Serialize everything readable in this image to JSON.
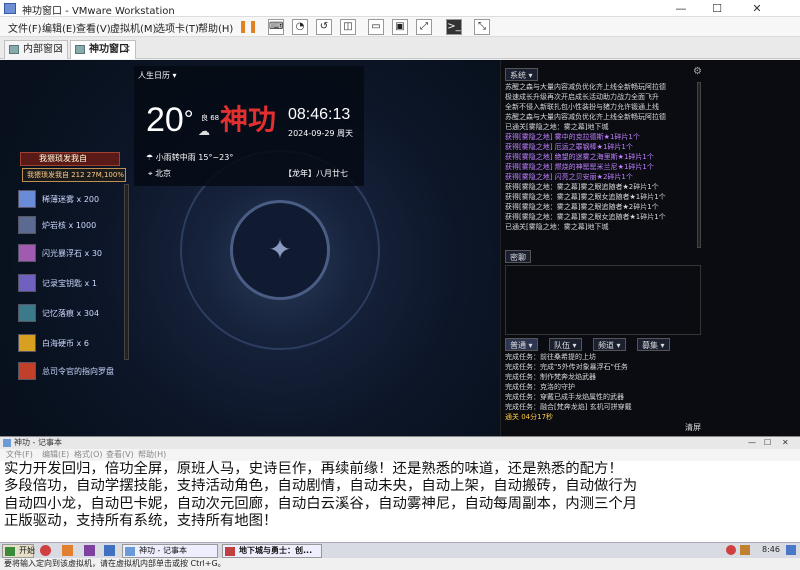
{
  "window": {
    "title": "神功窗口 - VMware Workstation"
  },
  "menubar": {
    "items": [
      "文件(F)",
      "编辑(E)",
      "查看(V)",
      "虚拟机(M)",
      "选项卡(T)",
      "帮助(H)"
    ]
  },
  "tabs": [
    {
      "label": "内部窗口",
      "active": false
    },
    {
      "label": "神功窗口",
      "active": true
    }
  ],
  "weather": {
    "calendar": "人生日历",
    "temperature": "20",
    "degree": "°",
    "aqi": "良 68",
    "brand": "神功",
    "time": "08:46:13",
    "date": "2024-09-29 周天",
    "condition": "小雨转中雨 15°~23°",
    "city": "北京",
    "lunar": "【龙年】八月廿七"
  },
  "inventory": {
    "header": "我猥琐发我自",
    "tooltip": "我猥琐发我自  212 27M,100%",
    "items": [
      {
        "label": "稀薄迷雾 x 200",
        "color": "#6a8cd8"
      },
      {
        "label": "炉岩核 x 1000",
        "color": "#5a6a90"
      },
      {
        "label": "闪光暴浮石 x 30",
        "color": "#a05ab0"
      },
      {
        "label": "记录宝钥匙 x 1",
        "color": "#7060c0"
      },
      {
        "label": "记忆落痕 x 304",
        "color": "#3a7a8a"
      },
      {
        "label": "白海硬币 x 6",
        "color": "#d8a020"
      },
      {
        "label": "总司令官的指向罗盘",
        "color": "#c0402a"
      }
    ]
  },
  "chat": {
    "system_tab": "系统",
    "gear": "⚙",
    "system_lines": [
      {
        "text": "苏醒之森与大量内容减负优化齐上线全新畅玩阿拉德",
        "color": "#d8d8d8"
      },
      {
        "text": "极速成长升级再次开启成长活动助力战力全面飞升",
        "color": "#d8d8d8"
      },
      {
        "text": "全新不侵入新联扎包小性装扮与猪力允许锻通上线",
        "color": "#d8d8d8"
      },
      {
        "text": "苏醒之森与大量内容减负优化齐上线全新畅玩阿拉德",
        "color": "#d8d8d8"
      },
      {
        "text": "已通关[雾隐之地：雾之幕]地下城",
        "color": "#d8d8d8"
      },
      {
        "text": "获得[雾隐之地] 雾中的克拉德斯★1碎片1个",
        "color": "#c080ff"
      },
      {
        "text": "获得[雾隐之地] 厄运之罪钢棒★1碎片1个",
        "color": "#c080ff"
      },
      {
        "text": "获得[雾隐之地] 绝望的迷雾之海里斯★1碎片1个",
        "color": "#c080ff"
      },
      {
        "text": "获得[雾隐之地] 燃烧的神罂罂米兰尼★1碎片1个",
        "color": "#c080ff"
      },
      {
        "text": "获得[雾隐之地] 闪亮之贝安丽★2碎片1个",
        "color": "#c080ff"
      },
      {
        "text": "获得[雾隐之地：雾之幕]雾之眼追随者★2碎片1个",
        "color": "#d8d8d8"
      },
      {
        "text": "获得[雾隐之地：雾之幕]雾之眼女追随者★1碎片1个",
        "color": "#d8d8d8"
      },
      {
        "text": "获得[雾隐之地：雾之幕]雾之眼追随者★2碎片1个",
        "color": "#d8d8d8"
      },
      {
        "text": "获得[雾隐之地：雾之幕]雾之眼女追随者★1碎片1个",
        "color": "#d8d8d8"
      },
      {
        "text": "已通关[雾隐之地：雾之幕]地下城",
        "color": "#d8d8d8"
      }
    ],
    "whisper_tab": "密聊",
    "channels": [
      "普通",
      "队伍",
      "频道",
      "募集"
    ],
    "task_lines": [
      {
        "text": "完成任务：前往桑希提的上坊",
        "color": "#d8d8d8"
      },
      {
        "text": "完成任务：完成\"5外传对象暴浮石\"任务",
        "color": "#d8d8d8"
      },
      {
        "text": "完成任务：制作梵奔龙焰武器",
        "color": "#d8d8d8"
      },
      {
        "text": "完成任务：克洛的守护",
        "color": "#d8d8d8"
      },
      {
        "text": "完成任务：穿戴已成手龙焰属性的武器",
        "color": "#d8d8d8"
      },
      {
        "text": "完成任务：融合[梵奔龙焰] 玄机可拼穿戴",
        "color": "#d8d8d8"
      },
      {
        "text": "通关 04分17秒",
        "color": "#ffcc40"
      }
    ],
    "clear": "清屏"
  },
  "notepad": {
    "title": "神功 - 记事本",
    "menus": [
      "文件(F)",
      "编辑(E)",
      "格式(O)",
      "查看(V)",
      "帮助(H)"
    ],
    "lines": [
      "实力开发回归，倍功全屏，原班人马，史诗巨作，再续前缘！还是熟悉的味道，还是熟悉的配方！",
      "多段倍功，自动学摆技能，支持活动角色，自动剧情，自动未央，自动上架，自动搬砖，自动做行为",
      "自动四小龙，自动巴卡妮，自动次元回廊，自动白云溪谷，自动雾神尼，自动每周副本，内测三个月",
      "正版驱动，支持所有系统，支持所有地图！"
    ]
  },
  "taskbar": {
    "start": "开始",
    "items": [
      "神功 - 记事本",
      "地下城与勇士：创..."
    ],
    "clock": "8:46"
  },
  "statusbar": {
    "text": "要将输入定向到该虚拟机，请在虚拟机内部单击或按 Ctrl+G。"
  }
}
